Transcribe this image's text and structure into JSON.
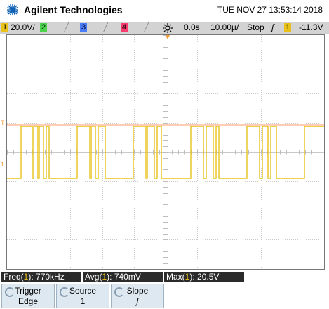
{
  "header": {
    "brand": "Agilent Technologies",
    "timestamp": "TUE NOV 27 13:53:14 2018"
  },
  "status": {
    "ch1_number": "1",
    "ch1_scale": "20.0V/",
    "ch2_number": "2",
    "ch3_number": "3",
    "ch4_number": "4",
    "trigger_position": "0.0s",
    "timebase": "10.00µ/",
    "run_state": "Stop",
    "trigger_symbol": "ʃ",
    "trigger_source_number": "1",
    "trigger_level": "-11.3V"
  },
  "colors": {
    "ch1": "#e8c21a",
    "ch2": "#4cd34c",
    "ch3": "#4a7cff",
    "ch4": "#ff3a6e",
    "trigger_line": "#ff9a6a",
    "marker": "#f29a3a"
  },
  "icons": [
    "agilent-spark-icon",
    "trigger-position-marker-icon",
    "trigger-level-marker-icon",
    "ground-marker-icon",
    "softkey-knob-icon"
  ],
  "waveform": {
    "high_level": 1,
    "low_level": 0,
    "trigger_level": 1,
    "periods": 5.5,
    "description_note": ""
  },
  "measurements": {
    "freq_label": "Freq(",
    "freq_ch": "1",
    "freq_value": "): 770kHz",
    "avg_label": "Avg(",
    "avg_ch": "1",
    "avg_value": "): 740mV",
    "max_label": "Max(",
    "max_ch": "1",
    "max_value": "): 20.5V"
  },
  "softkeys": {
    "trigger_title": "Trigger",
    "trigger_value": "Edge",
    "source_title": "Source",
    "source_value": "1",
    "slope_title": "Slope",
    "slope_value": "ʃ"
  },
  "markers": {
    "ground": "1"
  }
}
